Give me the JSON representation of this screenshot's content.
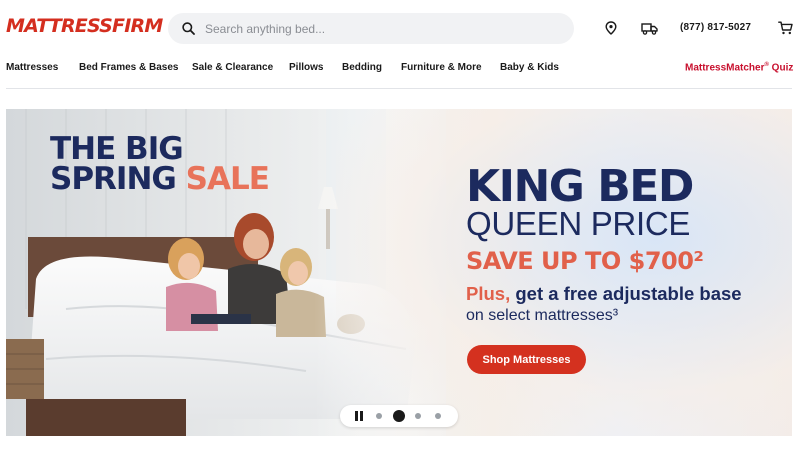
{
  "header": {
    "logo_text": "MATTRESSFIRM",
    "search_placeholder": "Search anything bed...",
    "phone": "(877) 817-5027",
    "icons": [
      "search-icon",
      "location-pin-icon",
      "delivery-truck-icon",
      "cart-icon"
    ]
  },
  "nav": {
    "items": [
      {
        "label": "Mattresses"
      },
      {
        "label": "Bed Frames & Bases"
      },
      {
        "label": "Sale & Clearance"
      },
      {
        "label": "Pillows"
      },
      {
        "label": "Bedding"
      },
      {
        "label": "Furniture & More"
      },
      {
        "label": "Baby & Kids"
      }
    ],
    "quiz_label": "MattressMatcher",
    "quiz_reg": "®",
    "quiz_suffix": " Quiz"
  },
  "hero": {
    "title_line1": "THE BIG",
    "title_line2a": "SPRING ",
    "title_line2b": "SALE",
    "headline": "KING BED",
    "subheadline": "QUEEN PRICE",
    "save_text": "SAVE UP TO $700²",
    "plus_word": "Plus,",
    "plus_rest": " get a free adjustable base",
    "select_text": "on select mattresses³",
    "cta_label": "Shop Mattresses"
  },
  "carousel": {
    "slide_count": 4,
    "active_slide": 2,
    "control": "pause-icon"
  },
  "colors": {
    "brand_red": "#d42e1f",
    "navy": "#1c2a5e",
    "coral": "#e1604a",
    "quiz_red": "#c8102e"
  }
}
